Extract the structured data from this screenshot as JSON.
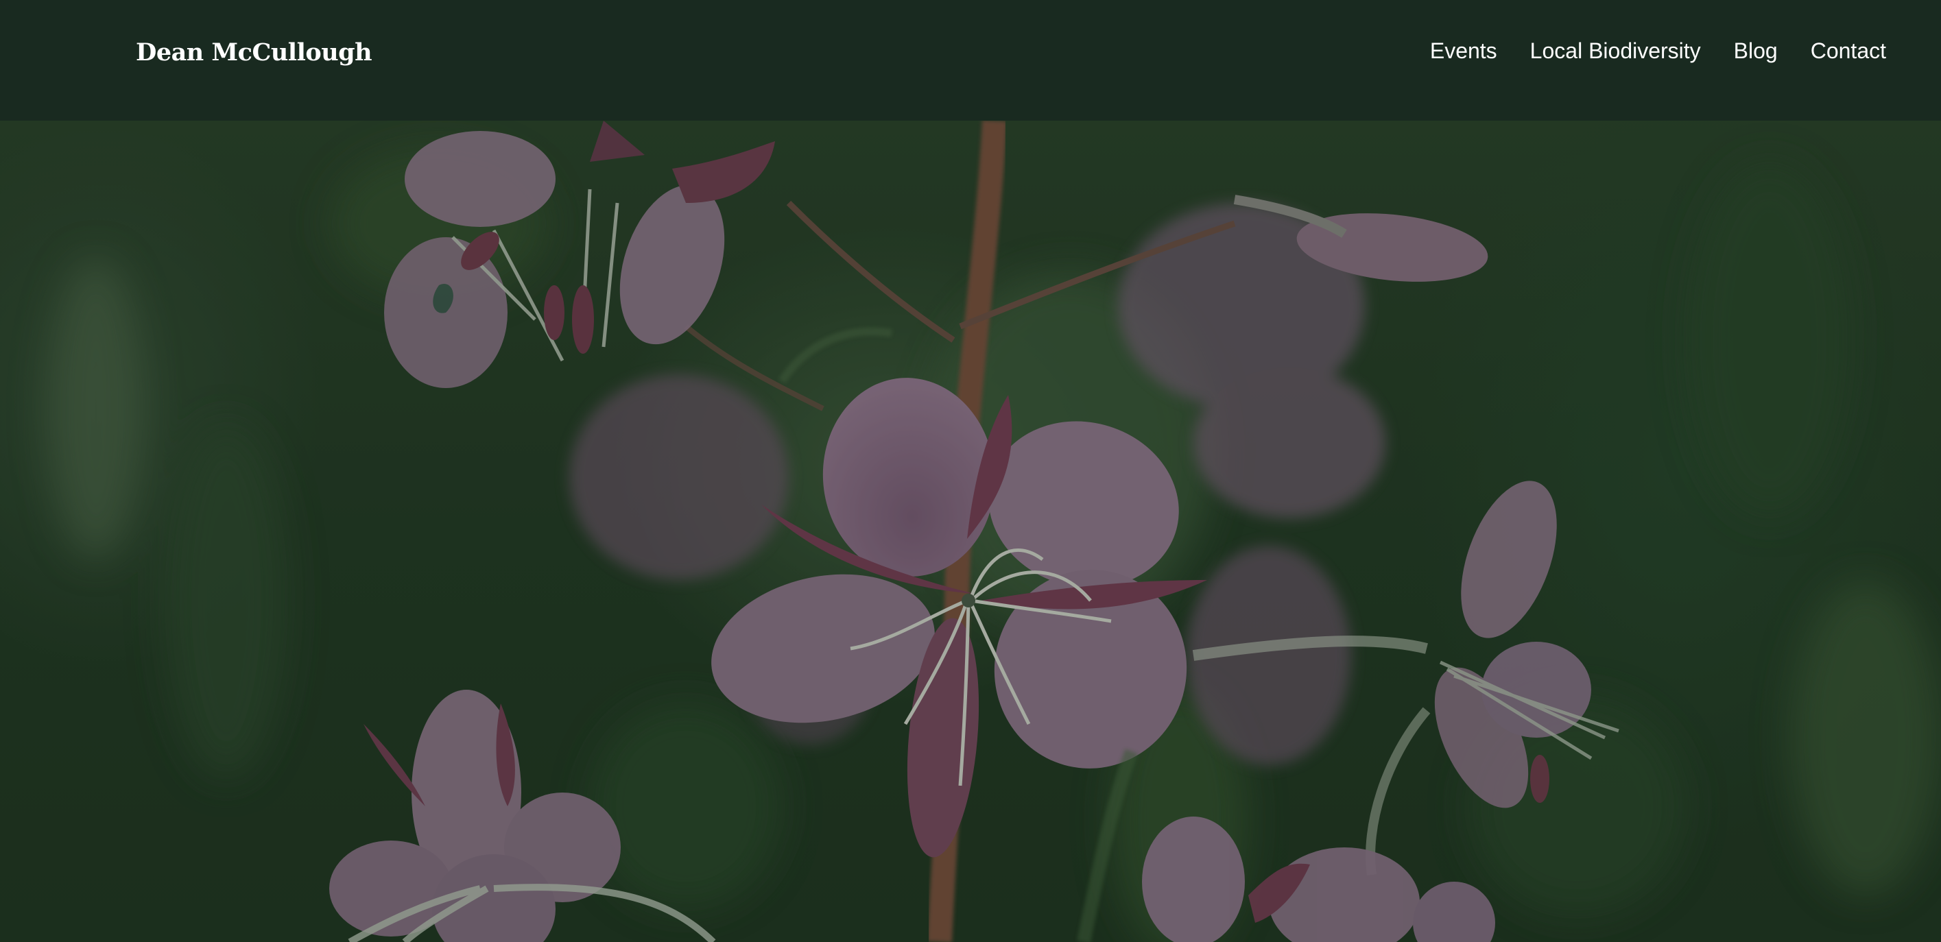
{
  "header": {
    "site_title": "Dean McCullough",
    "nav": [
      {
        "label": "Events"
      },
      {
        "label": "Local Biodiversity"
      },
      {
        "label": "Blog"
      },
      {
        "label": "Contact"
      }
    ]
  },
  "hero": {
    "image": "fireweed-flowers-photo"
  },
  "colors": {
    "header_bg": "#192a20",
    "text": "#ffffff",
    "petal": "#8c6a86",
    "foliage": "#2a4029"
  }
}
